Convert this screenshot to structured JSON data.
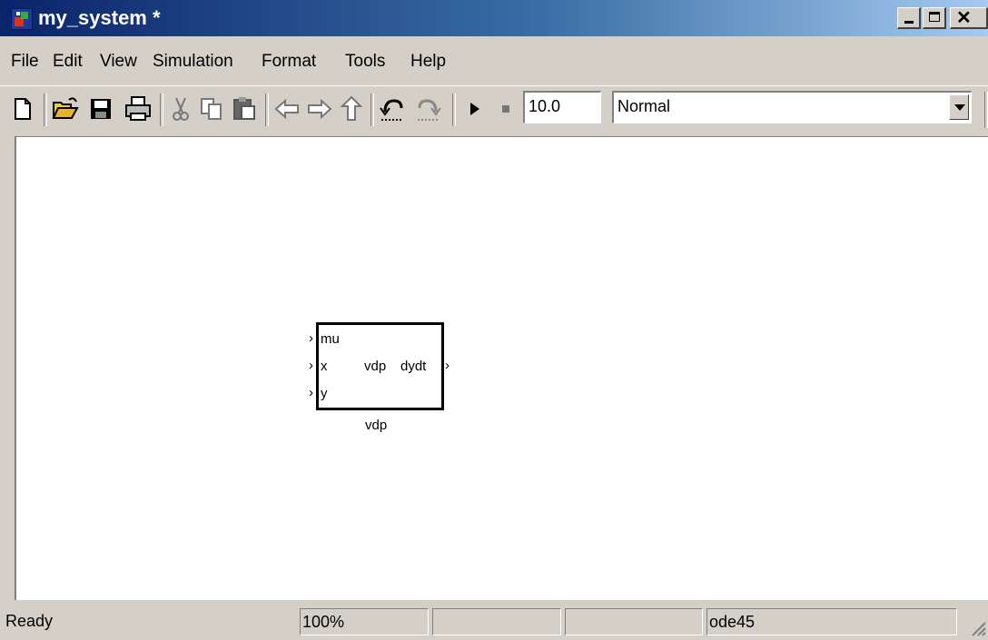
{
  "window": {
    "title": "my_system *",
    "controls": [
      "minimize",
      "maximize",
      "close"
    ]
  },
  "menu": [
    "File",
    "Edit",
    "View",
    "Simulation",
    "Format",
    "Tools",
    "Help"
  ],
  "toolbar": {
    "icons": [
      "new-icon",
      "open-icon",
      "save-icon",
      "print-icon",
      "cut-icon",
      "copy-icon",
      "paste-icon",
      "back-icon",
      "forward-icon",
      "up-icon",
      "undo-icon",
      "redo-icon",
      "play-icon",
      "stop-icon"
    ],
    "stop_time": "10.0",
    "sim_mode": "Normal"
  },
  "canvas": {
    "block": {
      "name": "vdp",
      "center_text": "vdp",
      "inputs": [
        "mu",
        "x",
        "y"
      ],
      "outputs": [
        "dydt"
      ]
    }
  },
  "statusbar": {
    "status": "Ready",
    "zoom": "100%",
    "solver": "ode45"
  },
  "colors": {
    "title_start": "#0a246a",
    "title_end": "#a6caf0",
    "chrome": "#d4d0c8",
    "canvas": "#ffffff"
  }
}
